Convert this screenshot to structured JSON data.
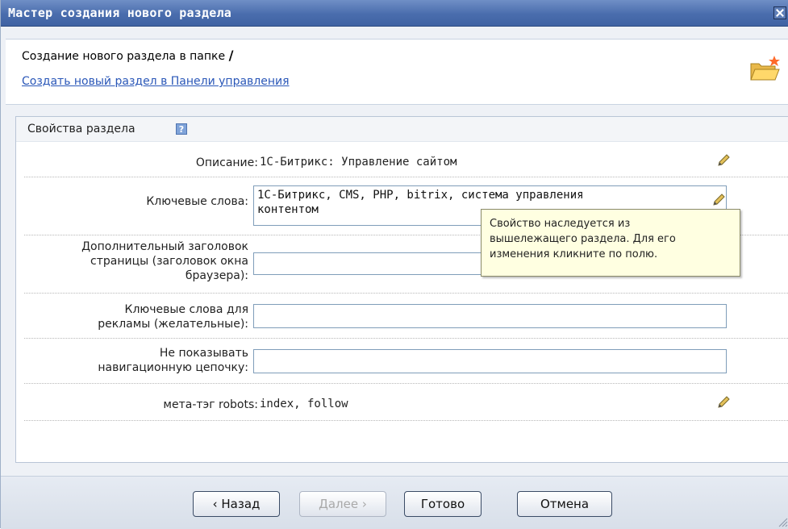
{
  "window": {
    "title": "Мастер создания нового раздела"
  },
  "header": {
    "line1_prefix": "Создание нового раздела в папке",
    "line1_folder": "/",
    "link": "Создать новый раздел в Панели управления"
  },
  "section": {
    "title": "Свойства раздела",
    "help": "?"
  },
  "properties": {
    "description": {
      "label": "Описание:",
      "value": "1С-Битрикс: Управление сайтом"
    },
    "keywords": {
      "label": "Ключевые слова:",
      "value_line1": "1С-Битрикс, CMS, PHP, bitrix, система управления",
      "value_line2": "контентом"
    },
    "title": {
      "label_line1": "Дополнительный заголовок",
      "label_line2": "страницы (заголовок окна",
      "label_line3": "браузера):",
      "value": ""
    },
    "ad_keywords": {
      "label_line1": "Ключевые слова для",
      "label_line2": "рекламы (желательные):",
      "value": ""
    },
    "hide_breadcrumb": {
      "label_line1": "Не показывать",
      "label_line2": "навигационную цепочку:",
      "value": ""
    },
    "robots": {
      "label": "мета-тэг robots:",
      "value": "index, follow"
    }
  },
  "tooltip": {
    "line1": "Свойство наследуется из",
    "line2": "вышележащего раздела. Для его",
    "line3": "изменения кликните по полю."
  },
  "buttons": {
    "back": "‹ Назад",
    "next": "Далее ›",
    "finish": "Готово",
    "cancel": "Отмена"
  },
  "icons": {
    "close": "close-icon",
    "folder": "new-folder-icon",
    "help": "help-icon",
    "edit": "pencil-icon",
    "resize": "resize-grip-icon"
  },
  "colors": {
    "titlebar": "#4a6dad",
    "link": "#2a57b8",
    "tooltip_bg": "#ffffe1"
  }
}
